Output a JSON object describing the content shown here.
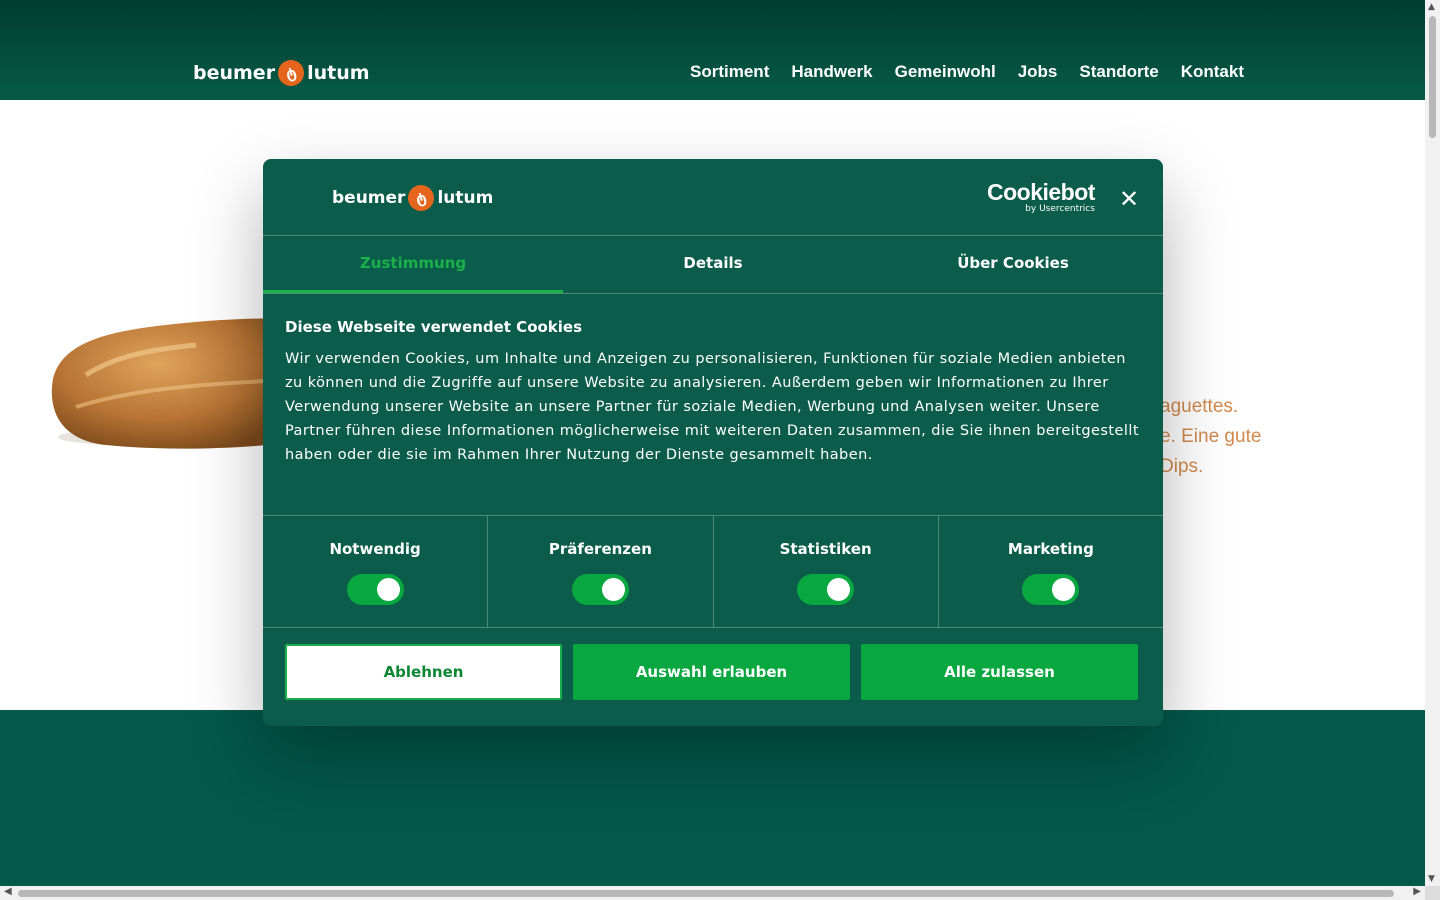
{
  "site": {
    "logo_left": "beumer",
    "logo_right": "lutum",
    "nav": [
      "Sortiment",
      "Handwerk",
      "Gemeinwohl",
      "Jobs",
      "Standorte",
      "Kontakt"
    ]
  },
  "background": {
    "text_lines": [
      "aguettes.",
      "e. Eine gute",
      "Dips."
    ]
  },
  "dialog": {
    "logo_left": "beumer",
    "logo_right": "lutum",
    "cookiebot_brand": "Cookiebot",
    "cookiebot_sub": "by Usercentrics",
    "tabs": [
      "Zustimmung",
      "Details",
      "Über Cookies"
    ],
    "active_tab": "Zustimmung",
    "title": "Diese Webseite verwendet Cookies",
    "text": "Wir verwenden Cookies, um Inhalte und Anzeigen zu personalisieren, Funktionen für soziale Medien anbieten zu können und die Zugriffe auf unsere Website zu analysieren. Außerdem geben wir Informationen zu Ihrer Verwendung unserer Website an unsere Partner für soziale Medien, Werbung und Analysen weiter. Unsere Partner führen diese Informationen möglicherweise mit weiteren Daten zusammen, die Sie ihnen bereitgestellt haben oder die sie im Rahmen Ihrer Nutzung der Dienste gesammelt haben.",
    "toggles": [
      {
        "label": "Notwendig",
        "on": true
      },
      {
        "label": "Präferenzen",
        "on": true
      },
      {
        "label": "Statistiken",
        "on": true
      },
      {
        "label": "Marketing",
        "on": true
      }
    ],
    "buttons": {
      "decline": "Ablehnen",
      "allow_selection": "Auswahl erlauben",
      "allow_all": "Alle zulassen"
    }
  },
  "colors": {
    "header_dark": "#003d30",
    "dialog_bg": "#0b5c4b",
    "accent_green": "#09a740",
    "bread_text": "#d28a4c",
    "logo_orange": "#e4651b"
  },
  "icons": [
    "close-icon",
    "logo-mark-icon",
    "scroll-arrow-icons"
  ]
}
